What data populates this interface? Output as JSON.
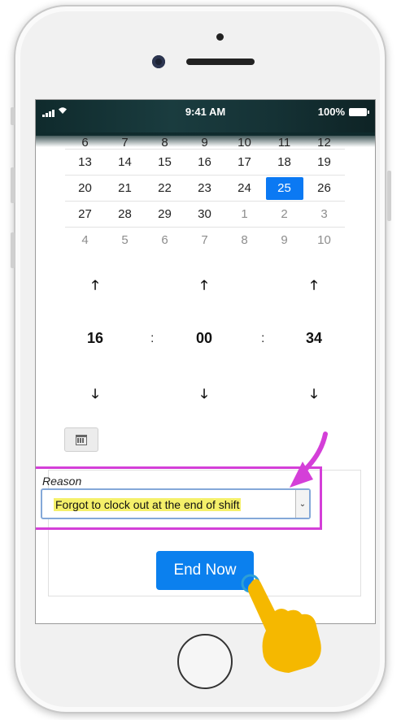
{
  "status_bar": {
    "time": "9:41 AM",
    "battery_text": "100%"
  },
  "calendar": {
    "rows": [
      [
        {
          "d": "6",
          "muted": false
        },
        {
          "d": "7",
          "muted": false
        },
        {
          "d": "8",
          "muted": false
        },
        {
          "d": "9",
          "muted": false
        },
        {
          "d": "10",
          "muted": false
        },
        {
          "d": "11",
          "muted": false
        },
        {
          "d": "12",
          "muted": false
        }
      ],
      [
        {
          "d": "13",
          "muted": false
        },
        {
          "d": "14",
          "muted": false
        },
        {
          "d": "15",
          "muted": false
        },
        {
          "d": "16",
          "muted": false
        },
        {
          "d": "17",
          "muted": false
        },
        {
          "d": "18",
          "muted": false
        },
        {
          "d": "19",
          "muted": false
        }
      ],
      [
        {
          "d": "20",
          "muted": false
        },
        {
          "d": "21",
          "muted": false
        },
        {
          "d": "22",
          "muted": false
        },
        {
          "d": "23",
          "muted": false
        },
        {
          "d": "24",
          "muted": false
        },
        {
          "d": "25",
          "muted": false,
          "selected": true
        },
        {
          "d": "26",
          "muted": false
        }
      ],
      [
        {
          "d": "27",
          "muted": false
        },
        {
          "d": "28",
          "muted": false
        },
        {
          "d": "29",
          "muted": false
        },
        {
          "d": "30",
          "muted": false
        },
        {
          "d": "1",
          "muted": true
        },
        {
          "d": "2",
          "muted": true
        },
        {
          "d": "3",
          "muted": true
        }
      ],
      [
        {
          "d": "4",
          "muted": true
        },
        {
          "d": "5",
          "muted": true
        },
        {
          "d": "6",
          "muted": true
        },
        {
          "d": "7",
          "muted": true
        },
        {
          "d": "8",
          "muted": true
        },
        {
          "d": "9",
          "muted": true
        },
        {
          "d": "10",
          "muted": true
        }
      ]
    ]
  },
  "time_picker": {
    "hours": "16",
    "minutes": "00",
    "seconds": "34",
    "separator": ":",
    "up_glyph": "🡑",
    "down_glyph": "🡓"
  },
  "form": {
    "reason_label": "Reason",
    "reason_value": "Forgot to clock out at the end of shift",
    "end_button_label": "End Now"
  },
  "colors": {
    "accent": "#0b80ee",
    "highlight_box": "#d43fd8",
    "text_highlight": "#f5f06a",
    "pointer_hand": "#f5b800"
  }
}
